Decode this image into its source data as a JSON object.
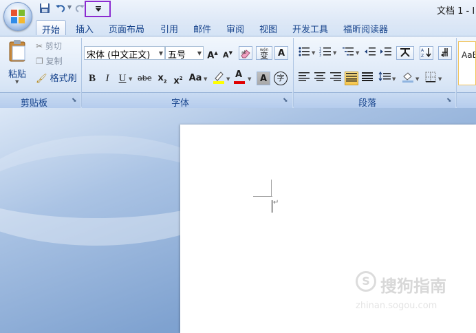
{
  "window": {
    "title": "文档 1 - I"
  },
  "tabs": [
    "开始",
    "插入",
    "页面布局",
    "引用",
    "邮件",
    "审阅",
    "视图",
    "开发工具",
    "福昕阅读器"
  ],
  "clipboard": {
    "paste": "粘贴",
    "cut": "剪切",
    "copy": "复制",
    "format_painter": "格式刷",
    "group_label": "剪贴板"
  },
  "font": {
    "name": "宋体 (中文正文)",
    "size": "五号",
    "grow": "A",
    "shrink": "A",
    "clear_format": "",
    "phonetic": "wén",
    "phonetic_char": "变",
    "border_char": "A",
    "bold": "B",
    "italic": "I",
    "underline": "U",
    "strike": "abe",
    "subscript": "x",
    "superscript": "x",
    "change_case": "Aa",
    "highlight": "",
    "font_color": "A",
    "shading": "A",
    "enclose": "字",
    "group_label": "字体"
  },
  "paragraph": {
    "group_label": "段落"
  },
  "styles": {
    "preview": "AaB"
  },
  "document": {
    "watermark": "搜狗指南",
    "watermark_url": "zhinan.sogou.com"
  },
  "colors": {
    "highlight": "#ffff00",
    "font_color": "#e00000",
    "qat_highlight": "#8b2bd0"
  }
}
